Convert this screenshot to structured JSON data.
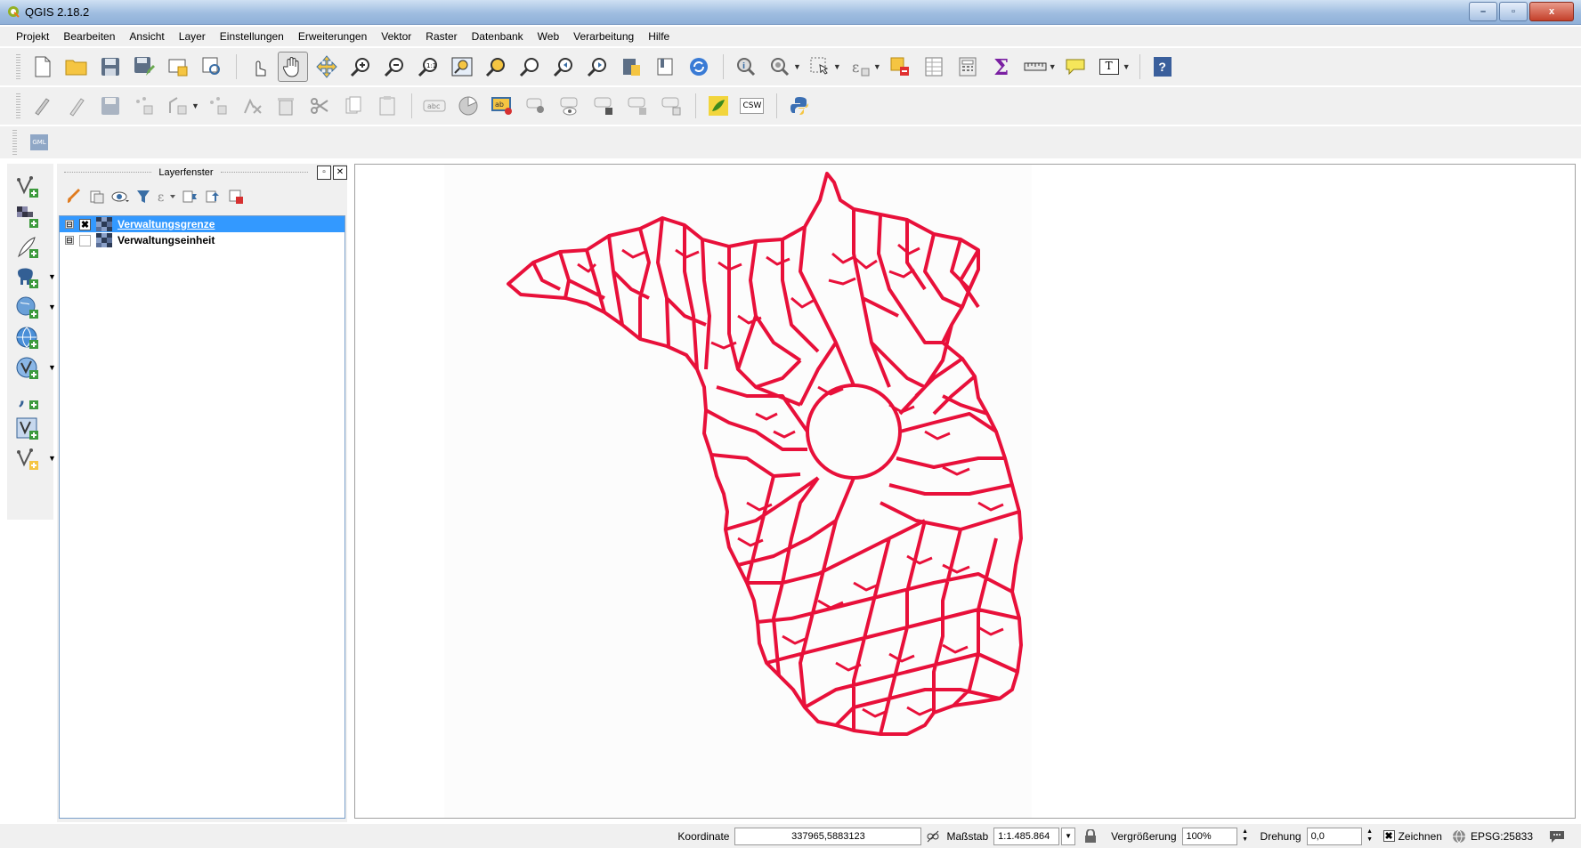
{
  "window": {
    "title": "QGIS 2.18.2",
    "min": "–",
    "max": "▫",
    "close": "x"
  },
  "menu": [
    "Projekt",
    "Bearbeiten",
    "Ansicht",
    "Layer",
    "Einstellungen",
    "Erweiterungen",
    "Vektor",
    "Raster",
    "Datenbank",
    "Web",
    "Verarbeitung",
    "Hilfe"
  ],
  "toolbar_text": {
    "sum": "Σ",
    "text_tool": "T",
    "help": "?",
    "csw": "CSW",
    "gml": "GML"
  },
  "layer_panel": {
    "title": "Layerfenster",
    "layers": [
      {
        "name": "Verwaltungsgrenze",
        "checked": true,
        "selected": true,
        "expander": "⊟",
        "check_mark": "✖"
      },
      {
        "name": "Verwaltungseinheit",
        "checked": false,
        "selected": false,
        "expander": "⊟",
        "check_mark": ""
      }
    ]
  },
  "map": {
    "feature_color": "#e8103a",
    "background": "#ffffff"
  },
  "statusbar": {
    "coord_label": "Koordinate",
    "coord_value": "337965,5883123",
    "scale_label": "Maßstab",
    "scale_value": "1:1.485.864",
    "magnifier_label": "Vergrößerung",
    "magnifier_value": "100%",
    "rotation_label": "Drehung",
    "rotation_value": "0,0",
    "render_label": "Zeichnen",
    "render_checked": "✖",
    "crs": "EPSG:25833"
  }
}
